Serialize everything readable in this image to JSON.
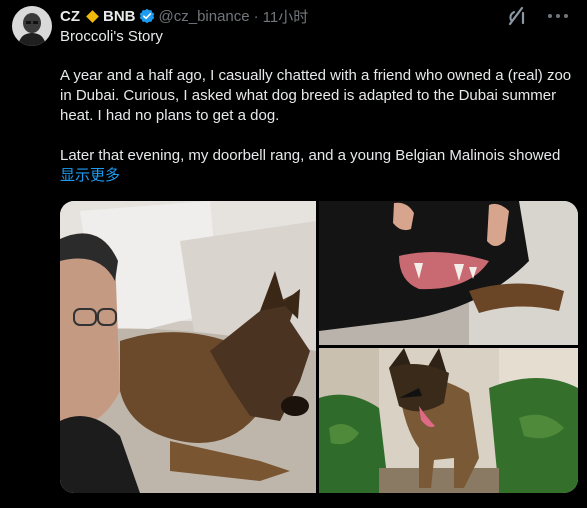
{
  "author": {
    "name": "CZ",
    "affiliate": "BNB",
    "handle": "@cz_binance",
    "separator": "·",
    "time": "11小时",
    "brand_color": "#f0b90b",
    "verified_color": "#1d9bf0"
  },
  "post": {
    "title": "Broccoli's Story",
    "paragraph_1": "A year and a half ago, I casually chatted with a friend who owned a (real) zoo in Dubai. Curious, I asked what dog breed is adapted to the Dubai summer heat. I had no plans to get a dog.",
    "paragraph_2": "Later that evening, my doorbell rang, and a young Belgian Malinois showed",
    "show_more": "显示更多",
    "link_color": "#1d9bf0"
  },
  "icons": {
    "grok": "grok-icon",
    "more": "more-icon",
    "verified": "verified-badge-icon",
    "brand": "bnb-diamond-icon"
  },
  "media": {
    "photos": [
      "selfie-with-dog-on-couch",
      "dog-teeth-closeup",
      "dog-in-garden"
    ]
  }
}
